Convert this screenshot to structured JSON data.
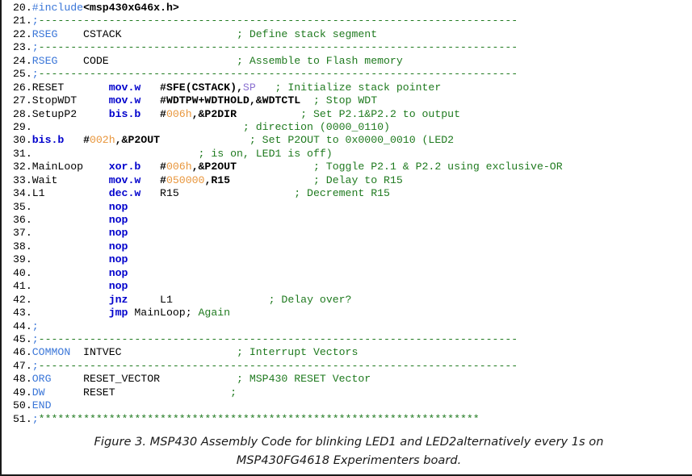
{
  "figure": {
    "caption_line1": "Figure 3. MSP430 Assembly Code for blinking LED1 and LED2alternatively every 1s on",
    "caption_line2": "MSP430FG4618 Experimenters board."
  },
  "colors": {
    "keyword_blue": "#0000cc",
    "directive_light_blue": "#3a76d8",
    "comment_green": "#1f7a1f",
    "literal_orange": "#e8963c",
    "register_purple": "#8a6fd0",
    "text_black": "#000000",
    "border": "#1a1a1a",
    "background": "#ffffff"
  },
  "code": {
    "language": "MSP430 Assembly",
    "lines": [
      {
        "number": "20.",
        "tokens": [
          {
            "t": "#include",
            "c": "c-ltblue"
          },
          {
            "t": "<msp430xG46x.h>",
            "c": "c-black c-bold"
          }
        ]
      },
      {
        "number": "21.",
        "tokens": [
          {
            "t": ";",
            "c": "c-ltblue"
          },
          {
            "t": "---------------------------------------------------------------------------",
            "c": "c-green"
          }
        ]
      },
      {
        "number": "22.",
        "tokens": [
          {
            "t": "RSEG",
            "c": "c-ltblue"
          },
          {
            "t": "    CSTACK                  ",
            "c": "c-black"
          },
          {
            "t": "; Define stack segment",
            "c": "c-green"
          }
        ]
      },
      {
        "number": "23.",
        "tokens": [
          {
            "t": ";",
            "c": "c-ltblue"
          },
          {
            "t": "---------------------------------------------------------------------------",
            "c": "c-green"
          }
        ]
      },
      {
        "number": "24.",
        "tokens": [
          {
            "t": "RSEG",
            "c": "c-ltblue"
          },
          {
            "t": "    CODE                    ",
            "c": "c-black"
          },
          {
            "t": "; Assemble to Flash memory",
            "c": "c-green"
          }
        ]
      },
      {
        "number": "25.",
        "tokens": [
          {
            "t": ";",
            "c": "c-ltblue"
          },
          {
            "t": "---------------------------------------------------------------------------",
            "c": "c-green"
          }
        ]
      },
      {
        "number": "26.",
        "tokens": [
          {
            "t": "RESET       ",
            "c": "c-black"
          },
          {
            "t": "mov.w",
            "c": "c-blue"
          },
          {
            "t": "   #SFE(CSTACK),",
            "c": "c-black c-bold"
          },
          {
            "t": "SP",
            "c": "c-purple"
          },
          {
            "t": "   ",
            "c": "c-black"
          },
          {
            "t": "; Initialize stack pointer",
            "c": "c-green"
          }
        ]
      },
      {
        "number": "27.",
        "tokens": [
          {
            "t": "StopWDT     ",
            "c": "c-black"
          },
          {
            "t": "mov.w",
            "c": "c-blue"
          },
          {
            "t": "   #WDTPW+WDTHOLD,&WDTCTL",
            "c": "c-black c-bold"
          },
          {
            "t": "  ",
            "c": "c-black"
          },
          {
            "t": "; Stop WDT",
            "c": "c-green"
          }
        ]
      },
      {
        "number": "28.",
        "tokens": [
          {
            "t": "SetupP2     ",
            "c": "c-black"
          },
          {
            "t": "bis.b",
            "c": "c-blue"
          },
          {
            "t": "   #",
            "c": "c-black c-bold"
          },
          {
            "t": "006h",
            "c": "c-orange"
          },
          {
            "t": ",&P2DIR",
            "c": "c-black c-bold"
          },
          {
            "t": "          ",
            "c": "c-black"
          },
          {
            "t": "; Set P2.1&P2.2 to output",
            "c": "c-green"
          }
        ]
      },
      {
        "number": "29.",
        "tokens": [
          {
            "t": "                                 ",
            "c": "c-black"
          },
          {
            "t": "; direction (0000_0110)",
            "c": "c-green"
          }
        ]
      },
      {
        "number": "30.",
        "tokens": [
          {
            "t": "bis.b",
            "c": "c-blue"
          },
          {
            "t": "   #",
            "c": "c-black c-bold"
          },
          {
            "t": "002h",
            "c": "c-orange"
          },
          {
            "t": ",&P2OUT",
            "c": "c-black c-bold"
          },
          {
            "t": "              ",
            "c": "c-black"
          },
          {
            "t": "; Set P2OUT to 0x0000_0010 (LED2",
            "c": "c-green"
          }
        ]
      },
      {
        "number": "31.",
        "tokens": [
          {
            "t": "                          ",
            "c": "c-black"
          },
          {
            "t": "; is on, LED1 is off)",
            "c": "c-green"
          }
        ]
      },
      {
        "number": "32.",
        "tokens": [
          {
            "t": "MainLoop    ",
            "c": "c-black"
          },
          {
            "t": "xor.b",
            "c": "c-blue"
          },
          {
            "t": "   #",
            "c": "c-black c-bold"
          },
          {
            "t": "006h",
            "c": "c-orange"
          },
          {
            "t": ",&P2OUT",
            "c": "c-black c-bold"
          },
          {
            "t": "            ",
            "c": "c-black"
          },
          {
            "t": "; Toggle P2.1 & P2.2 using exclusive-OR",
            "c": "c-green"
          }
        ]
      },
      {
        "number": "33.",
        "tokens": [
          {
            "t": "Wait        ",
            "c": "c-black"
          },
          {
            "t": "mov.w",
            "c": "c-blue"
          },
          {
            "t": "   #",
            "c": "c-black c-bold"
          },
          {
            "t": "050000",
            "c": "c-orange"
          },
          {
            "t": ",R15",
            "c": "c-black c-bold"
          },
          {
            "t": "             ",
            "c": "c-black"
          },
          {
            "t": "; Delay to R15",
            "c": "c-green"
          }
        ]
      },
      {
        "number": "34.",
        "tokens": [
          {
            "t": "L1          ",
            "c": "c-black"
          },
          {
            "t": "dec.w",
            "c": "c-blue"
          },
          {
            "t": "   R15",
            "c": "c-black"
          },
          {
            "t": "                  ",
            "c": "c-black"
          },
          {
            "t": "; Decrement R15",
            "c": "c-green"
          }
        ]
      },
      {
        "number": "35.",
        "tokens": [
          {
            "t": "            ",
            "c": "c-black"
          },
          {
            "t": "nop",
            "c": "c-blue"
          }
        ]
      },
      {
        "number": "36.",
        "tokens": [
          {
            "t": "            ",
            "c": "c-black"
          },
          {
            "t": "nop",
            "c": "c-blue"
          }
        ]
      },
      {
        "number": "37.",
        "tokens": [
          {
            "t": "            ",
            "c": "c-black"
          },
          {
            "t": "nop",
            "c": "c-blue"
          }
        ]
      },
      {
        "number": "38.",
        "tokens": [
          {
            "t": "            ",
            "c": "c-black"
          },
          {
            "t": "nop",
            "c": "c-blue"
          }
        ]
      },
      {
        "number": "39.",
        "tokens": [
          {
            "t": "            ",
            "c": "c-black"
          },
          {
            "t": "nop",
            "c": "c-blue"
          }
        ]
      },
      {
        "number": "40.",
        "tokens": [
          {
            "t": "            ",
            "c": "c-black"
          },
          {
            "t": "nop",
            "c": "c-blue"
          }
        ]
      },
      {
        "number": "41.",
        "tokens": [
          {
            "t": "            ",
            "c": "c-black"
          },
          {
            "t": "nop",
            "c": "c-blue"
          }
        ]
      },
      {
        "number": "42.",
        "tokens": [
          {
            "t": "            ",
            "c": "c-black"
          },
          {
            "t": "jnz",
            "c": "c-blue"
          },
          {
            "t": "     L1",
            "c": "c-black"
          },
          {
            "t": "               ",
            "c": "c-black"
          },
          {
            "t": "; Delay over?",
            "c": "c-green"
          }
        ]
      },
      {
        "number": "43.",
        "tokens": [
          {
            "t": "            ",
            "c": "c-black"
          },
          {
            "t": "jmp",
            "c": "c-blue"
          },
          {
            "t": " MainLoop;",
            "c": "c-black"
          },
          {
            "t": " Again",
            "c": "c-green"
          }
        ]
      },
      {
        "number": "44.",
        "tokens": [
          {
            "t": ";",
            "c": "c-ltblue"
          }
        ]
      },
      {
        "number": "45.",
        "tokens": [
          {
            "t": ";",
            "c": "c-ltblue"
          },
          {
            "t": "---------------------------------------------------------------------------",
            "c": "c-green"
          }
        ]
      },
      {
        "number": "46.",
        "tokens": [
          {
            "t": "COMMON",
            "c": "c-ltblue"
          },
          {
            "t": "  INTVEC                  ",
            "c": "c-black"
          },
          {
            "t": "; Interrupt Vectors",
            "c": "c-green"
          }
        ]
      },
      {
        "number": "47.",
        "tokens": [
          {
            "t": ";",
            "c": "c-ltblue"
          },
          {
            "t": "---------------------------------------------------------------------------",
            "c": "c-green"
          }
        ]
      },
      {
        "number": "48.",
        "tokens": [
          {
            "t": "ORG",
            "c": "c-ltblue"
          },
          {
            "t": "     RESET_VECTOR            ",
            "c": "c-black"
          },
          {
            "t": "; MSP430 RESET Vector",
            "c": "c-green"
          }
        ]
      },
      {
        "number": "49.",
        "tokens": [
          {
            "t": "DW",
            "c": "c-ltblue"
          },
          {
            "t": "      RESET                  ",
            "c": "c-black"
          },
          {
            "t": ";",
            "c": "c-green"
          }
        ]
      },
      {
        "number": "50.",
        "tokens": [
          {
            "t": "END",
            "c": "c-ltblue"
          }
        ]
      },
      {
        "number": "51.",
        "tokens": [
          {
            "t": ";",
            "c": "c-ltblue"
          },
          {
            "t": "*********************************************************************",
            "c": "c-green"
          }
        ]
      }
    ]
  }
}
